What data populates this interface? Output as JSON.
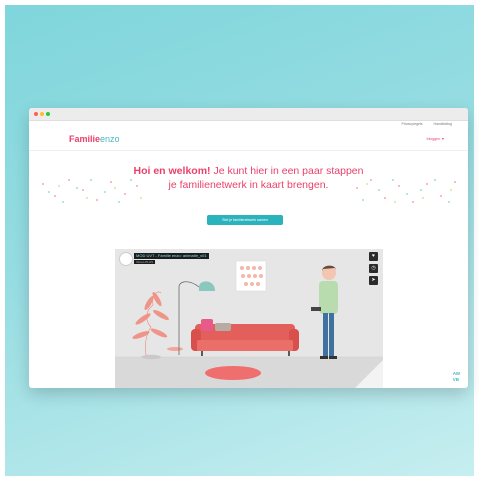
{
  "topnav": {
    "privacy": "Privacyregels",
    "manual": "Handleiding"
  },
  "header": {
    "logo_part1": "Familie",
    "logo_part2": "enzo",
    "login": "Inloggen",
    "login_icon": "heart-icon"
  },
  "hero": {
    "bold": "Hoi en welkom!",
    "line1": " Je kunt hier in een paar stappen",
    "line2": "je familienetwerk in kaart brengen."
  },
  "cta": {
    "label": "Stel je familienetwerk samen"
  },
  "video": {
    "title": "MOD UVT - Familie enzo: animatie_v01",
    "subtitle": "Vimeo  PLUS",
    "icons": [
      "heart-icon",
      "clock-icon",
      "send-icon"
    ]
  },
  "badge": {
    "line1": "AW",
    "line2": "VB"
  },
  "colors": {
    "accent": "#e9416a",
    "teal": "#2bb3bd"
  }
}
